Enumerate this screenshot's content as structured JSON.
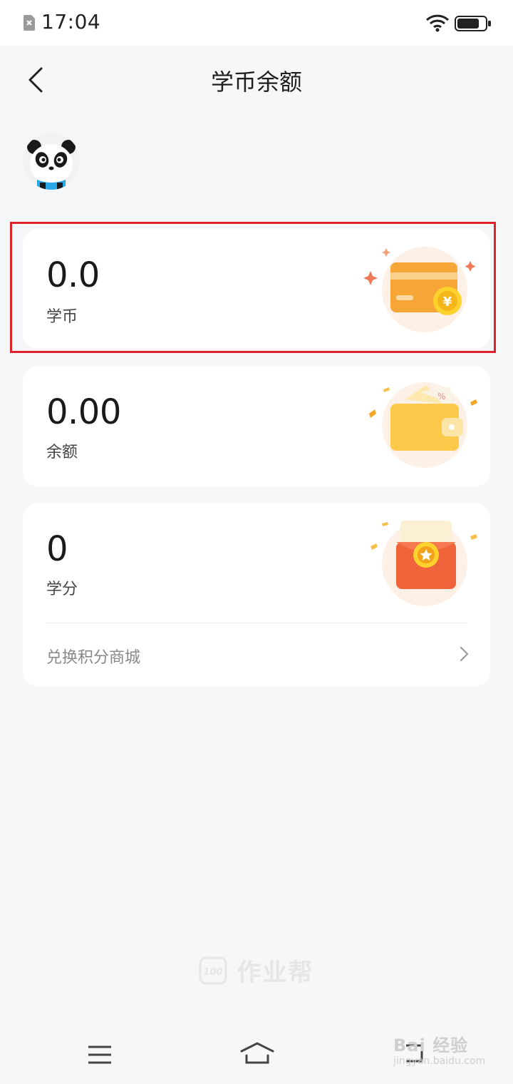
{
  "status_bar": {
    "time": "17:04",
    "icons": [
      "sim-error-icon",
      "wifi-icon",
      "battery-icon"
    ]
  },
  "header": {
    "back_icon": "chevron-left-icon",
    "title": "学币余额"
  },
  "avatar": {
    "icon": "panda-avatar-icon"
  },
  "cards": [
    {
      "value": "0.0",
      "label": "学币",
      "illustration": "card-coin-icon"
    },
    {
      "value": "0.00",
      "label": "余额",
      "illustration": "wallet-icon"
    },
    {
      "value": "0",
      "label": "学分",
      "illustration": "red-envelope-icon",
      "link_label": "兑换积分商城",
      "link_icon": "chevron-right-icon"
    }
  ],
  "footer_brand": {
    "name": "作业帮",
    "icon": "100-logo-icon"
  },
  "nav_bar": {
    "icons": [
      "menu-icon",
      "home-icon",
      "back-icon"
    ]
  },
  "watermark": {
    "text": "Bai 经验",
    "url": "jingyan.baidu.com"
  },
  "colors": {
    "background": "#f6f7f9",
    "card": "#ffffff",
    "highlight_border": "#e0232a",
    "accent_orange": "#f7a93b",
    "accent_red": "#f0643c"
  }
}
